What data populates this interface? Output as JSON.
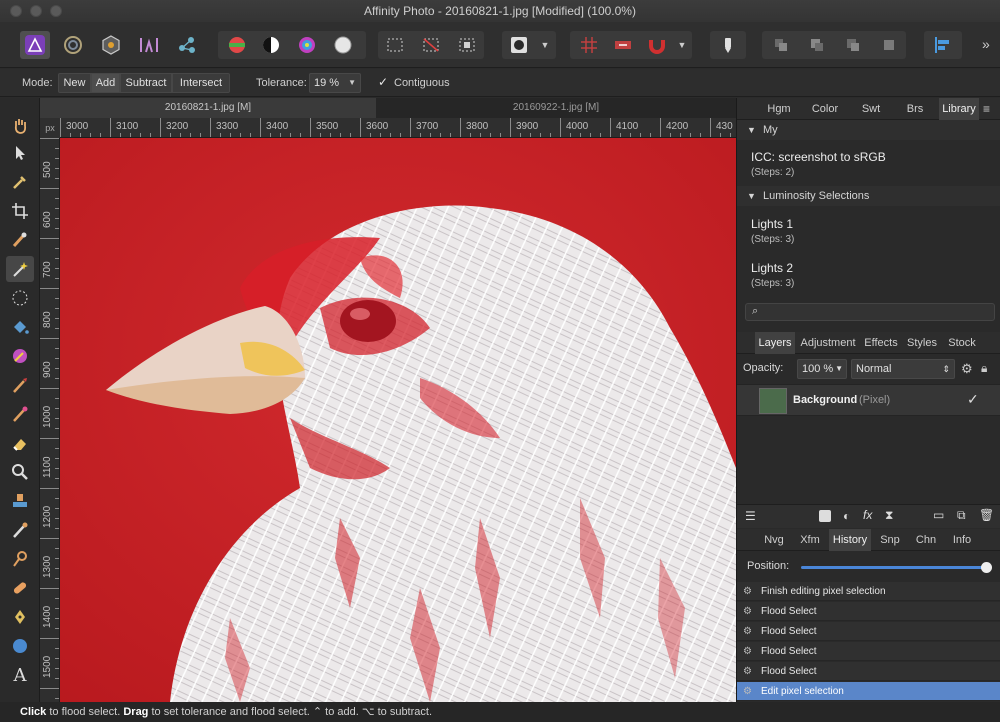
{
  "window": {
    "title": "Affinity Photo - 20160821-1.jpg [Modified] (100.0%)"
  },
  "context": {
    "mode_label": "Mode:",
    "mode_new": "New",
    "mode_add": "Add",
    "mode_subtract": "Subtract",
    "mode_intersect": "Intersect",
    "tolerance_label": "Tolerance:",
    "tolerance_value": "19 %",
    "contiguous_label": "Contiguous",
    "contiguous_checked": true
  },
  "document": {
    "tabs": [
      "20160821-1.jpg [M]",
      "20160922-1.jpg [M]"
    ],
    "ruler_unit": "px",
    "hruler": [
      "3000",
      "3100",
      "3200",
      "3300",
      "3400",
      "3500",
      "3600",
      "3700",
      "3800",
      "3900",
      "4000",
      "4100",
      "4200",
      "430"
    ],
    "vruler": [
      "500",
      "600",
      "700",
      "800",
      "900",
      "1000",
      "1100",
      "1200",
      "1300",
      "1400",
      "1500"
    ]
  },
  "library": {
    "tabs": [
      "Hgm",
      "Color",
      "Swt",
      "Brs",
      "Library"
    ],
    "active_tab": "Library",
    "sections": [
      {
        "name": "My",
        "macros": [
          {
            "title": "ICC: screenshot to sRGB",
            "steps": "(Steps: 2)"
          }
        ]
      },
      {
        "name": "Luminosity Selections",
        "macros": [
          {
            "title": "Lights 1",
            "steps": "(Steps: 3)"
          },
          {
            "title": "Lights 2",
            "steps": "(Steps: 3)"
          }
        ]
      }
    ]
  },
  "layers": {
    "tabs": [
      "Layers",
      "Adjustment",
      "Effects",
      "Styles",
      "Stock"
    ],
    "active_tab": "Layers",
    "opacity_label": "Opacity:",
    "opacity_value": "100 %",
    "blend_mode": "Normal",
    "layer_name": "Background",
    "layer_type": "(Pixel)"
  },
  "history": {
    "tabs": [
      "Nvg",
      "Xfm",
      "History",
      "Snp",
      "Chn",
      "Info"
    ],
    "active_tab": "History",
    "position_label": "Position:",
    "position": 1.0,
    "items": [
      "Finish editing pixel selection",
      "Flood Select",
      "Flood Select",
      "Flood Select",
      "Flood Select",
      "Edit pixel selection"
    ],
    "selected_index": 5
  },
  "status": {
    "click_word": "Click",
    "click_text": " to flood select. ",
    "drag_word": "Drag",
    "drag_text": " to set tolerance and flood select. ⌃ to add. ⌥ to subtract."
  },
  "colors": {
    "canvas_red": "#c81d22",
    "selection_blue": "#5a86c9",
    "panel_dark": "#2a2a2a"
  }
}
